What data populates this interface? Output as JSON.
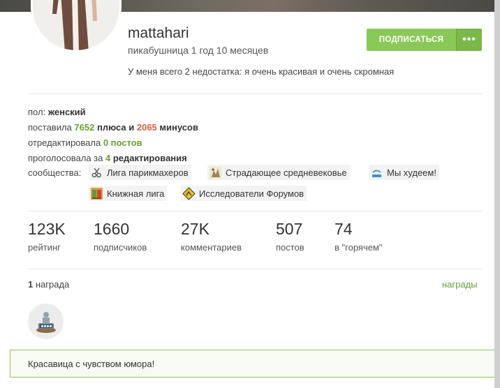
{
  "profile": {
    "username": "mattahari",
    "member_since": "пикабушница 1 год 10 месяцев",
    "bio": "У меня всего 2 недостатка: я очень красивая и очень скромная",
    "subscribe_label": "ПОДПИСАТЬСЯ",
    "more_label": "•••"
  },
  "info": {
    "gender_label": "пол:",
    "gender_value": "женский",
    "rated_prefix": "поставила",
    "pluses": "7652",
    "pluses_word": "плюса и",
    "minuses": "2065",
    "minuses_word": "минусов",
    "edited_prefix": "отредактировала",
    "edited_value": "0 постов",
    "voted_prefix": "проголосовала за",
    "voted_count": "4",
    "voted_word": "редактирования",
    "communities_label": "сообщества:"
  },
  "communities": [
    {
      "name": "Лига парикмахеров",
      "icon": "hairdresser-icon"
    },
    {
      "name": "Страдающее средневековье",
      "icon": "medieval-icon"
    },
    {
      "name": "Мы худеем!",
      "icon": "scale-icon"
    },
    {
      "name": "Книжная лига",
      "icon": "book-icon"
    },
    {
      "name": "Исследователи Форумов",
      "icon": "forum-explorer-icon"
    }
  ],
  "stats": [
    {
      "value": "123K",
      "label": "рейтинг"
    },
    {
      "value": "1660",
      "label": "подписчиков"
    },
    {
      "value": "27K",
      "label": "комментариев"
    },
    {
      "value": "507",
      "label": "постов"
    },
    {
      "value": "74",
      "label": "в \"горячем\""
    }
  ],
  "awards": {
    "count": "1",
    "count_word": "награда",
    "link_label": "награды",
    "badge_icon": "award-1000-icon"
  },
  "note": {
    "text": "Красавица с чувством юмора!"
  },
  "colors": {
    "accent": "#8ac858",
    "positive": "#65a135",
    "negative": "#e05b43"
  }
}
